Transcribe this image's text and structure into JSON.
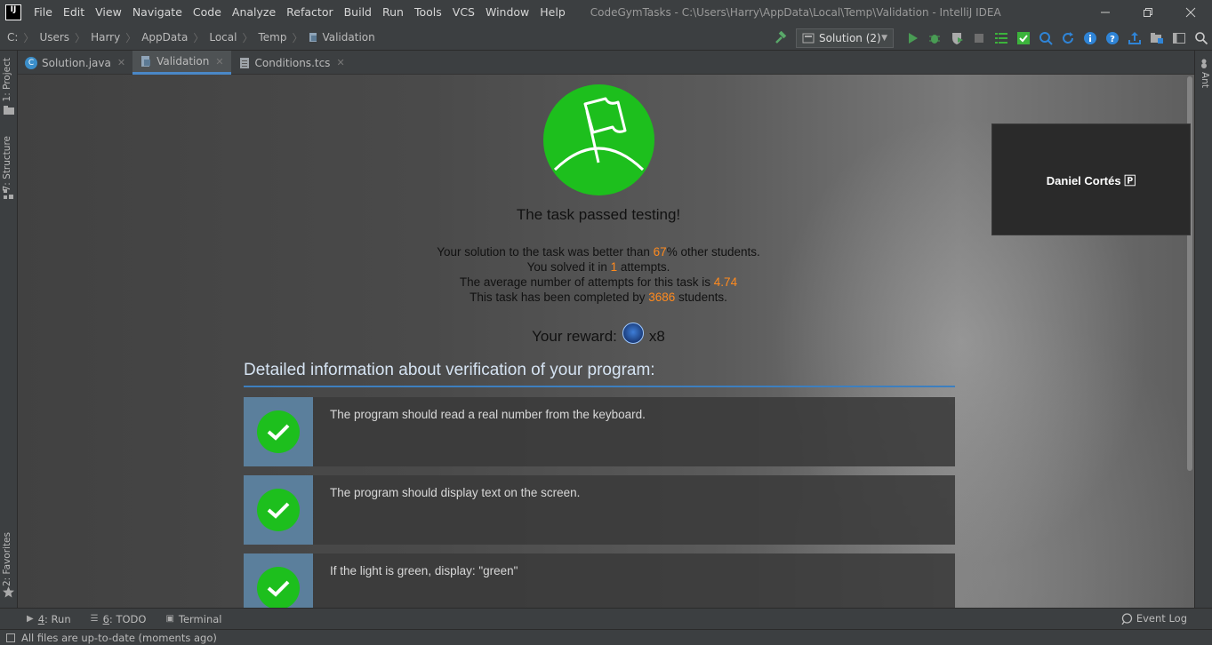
{
  "titlebar": {
    "logo": "IJ",
    "menu": [
      "File",
      "Edit",
      "View",
      "Navigate",
      "Code",
      "Analyze",
      "Refactor",
      "Build",
      "Run",
      "Tools",
      "VCS",
      "Window",
      "Help"
    ],
    "window_title": "CodeGymTasks - C:\\Users\\Harry\\AppData\\Local\\Temp\\Validation - IntelliJ IDEA",
    "controls": [
      "minimize",
      "restore",
      "close"
    ]
  },
  "navbar": {
    "breadcrumbs": [
      "C:",
      "Users",
      "Harry",
      "AppData",
      "Local",
      "Temp",
      "Validation"
    ],
    "run_config": "Solution (2)"
  },
  "left_strip": {
    "project": "1: Project",
    "structure": "7: Structure",
    "favorites": "2: Favorites"
  },
  "right_strip": {
    "ant": "Ant"
  },
  "tabs": [
    {
      "label": "Solution.java",
      "active": false
    },
    {
      "label": "Validation",
      "active": true
    },
    {
      "label": "Conditions.tcs",
      "active": false
    }
  ],
  "result": {
    "title": "The task passed testing!",
    "line1_pre": "Your solution to the task was better than ",
    "line1_val": "67",
    "line1_post": "% other students.",
    "line2_pre": "You solved it in ",
    "line2_val": "1",
    "line2_post": " attempts.",
    "line3_pre": "The average number of attempts for this task is ",
    "line3_val": "4.74",
    "line4_pre": "This task has been completed by ",
    "line4_val": "3686",
    "line4_post": " students.",
    "reward_label": "Your reward:",
    "reward_count": "x8"
  },
  "details": {
    "heading": "Detailed information about verification of your program:",
    "checks": [
      "The program should read a real number from the keyboard.",
      "The program should display text on the screen.",
      "If the light is green, display: \"green\""
    ]
  },
  "popup": {
    "name": "Daniel  Cortés 🄿"
  },
  "bottom_tools": {
    "run_num": "4",
    "run_label": ": Run",
    "todo_num": "6",
    "todo_label": ": TODO",
    "terminal": "Terminal",
    "event_log": "Event Log"
  },
  "status": {
    "text": "All files are up-to-date (moments ago)"
  },
  "colors": {
    "accent_blue": "#4a88c7",
    "success_green": "#1dbf1d",
    "highlight_orange": "#ff8a1e"
  }
}
